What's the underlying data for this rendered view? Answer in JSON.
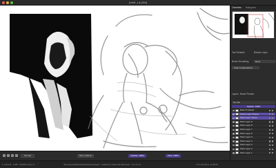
{
  "window": {
    "title": "[Untit...] ● [404]"
  },
  "panel": {
    "tabs": [
      "Overview",
      "Histogram"
    ],
    "tool_defaults_label": "Tool Defaults",
    "blend_label": "Blender Layer",
    "brush_smoothing_label": "Brush Smoothing",
    "brush_smoothing_value": "None",
    "snap_label": "Snap to Appearance",
    "layer_tabs": [
      "Layers",
      "Brush Presets"
    ],
    "blend_mode": "Normal",
    "opacity_label": "Opacity: 100%",
    "layers": [
      {
        "name": "Basic # Header",
        "selected": false
      },
      {
        "name": "Fleshy Light Shapes",
        "selected": true
      },
      {
        "name": "Paint Layer Viewer",
        "selected": true
      },
      {
        "name": "Paint Layer 9",
        "selected": false
      },
      {
        "name": "Paint Layer 8",
        "selected": false
      },
      {
        "name": "Paint Layer 7",
        "selected": false
      },
      {
        "name": "Paint Layer 6",
        "selected": false
      },
      {
        "name": "Paint Layer 5",
        "selected": false
      },
      {
        "name": "Paint Layer 4",
        "selected": false
      },
      {
        "name": "Paint Layer 3",
        "selected": false
      },
      {
        "name": "Paint Layer 2",
        "selected": false
      },
      {
        "name": "Paint Layer 1",
        "selected": false
      }
    ]
  },
  "statusbar": {
    "blend_mode": "Normal",
    "size_label": "Size: 0.22mm",
    "opacity_label": "Opacity: 100%",
    "flow_label": "Flow: 100%"
  },
  "bottombar": {
    "left_text": "b: 0.6mm9 · 0.345 · 25.0/05 in size 71",
    "center_text": "/Documents/Illustration/stock/user/images/ · Untitled (1) / illust/ dsb 400 pixels · 4.2 x 6.1 in",
    "right_text": "2,2 2,33,200 px, at 38.0%"
  },
  "colors": {
    "accent": "#5d4ea8",
    "panel_bg": "#2c2c2c",
    "canvas_bg": "#ffffff"
  }
}
